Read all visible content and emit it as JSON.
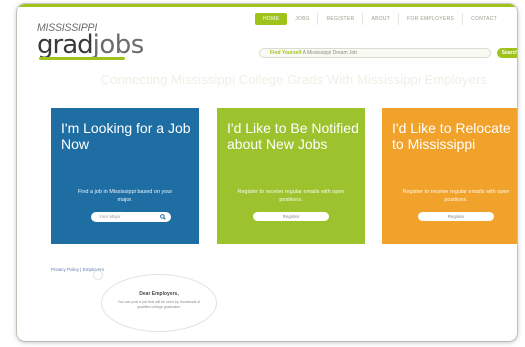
{
  "nav": {
    "items": [
      "HOME",
      "JOBS",
      "REGISTER",
      "ABOUT",
      "FOR EMPLOYERS",
      "CONTACT"
    ],
    "active_index": 0
  },
  "logo": {
    "state": "MISSISSIPPI",
    "grad": "grad",
    "jobs": "jobs"
  },
  "search": {
    "accent": "Find Yourself",
    "text": " A Mississippi Dream Job",
    "button_label": "Search"
  },
  "tagline": "Connecting Mississippi College Grads With Mississippi Employers",
  "cards": [
    {
      "title": "I'm Looking for a Job Now",
      "description": "Find a job in Mississippi based on your major.",
      "input_placeholder": "Your Major",
      "button_icon": "search-icon",
      "color": "#1f6ea3"
    },
    {
      "title": "I'd Like to Be Notified about New Jobs",
      "description": "Register to receive regular emails with open positions.",
      "button_label": "Register",
      "color": "#9cc22e"
    },
    {
      "title": "I'd Like to Relocate to Mississippi",
      "description": "Register to receive regular emails with open positions.",
      "button_label": "Register",
      "color": "#f1a22b"
    }
  ],
  "footer": {
    "privacy": "Privacy Policy",
    "separator": " | ",
    "employers": "Employers"
  },
  "bubble": {
    "title": "Dear Employers,",
    "text": "You can post a job that will be seen by thousands of qualified college graduates."
  },
  "colors": {
    "accent": "#9ec31d",
    "blue": "#1f6ea3",
    "green": "#9cc22e",
    "orange": "#f1a22b"
  }
}
